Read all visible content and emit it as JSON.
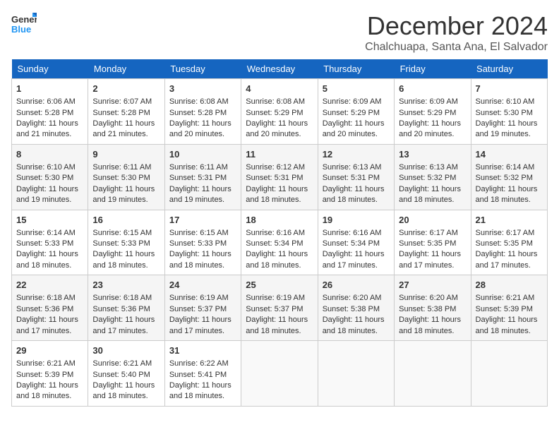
{
  "header": {
    "logo_general": "General",
    "logo_blue": "Blue",
    "month_title": "December 2024",
    "location": "Chalchuapa, Santa Ana, El Salvador"
  },
  "days_of_week": [
    "Sunday",
    "Monday",
    "Tuesday",
    "Wednesday",
    "Thursday",
    "Friday",
    "Saturday"
  ],
  "weeks": [
    [
      {
        "day": "1",
        "sunrise": "6:06 AM",
        "sunset": "5:28 PM",
        "daylight": "11 hours and 21 minutes."
      },
      {
        "day": "2",
        "sunrise": "6:07 AM",
        "sunset": "5:28 PM",
        "daylight": "11 hours and 21 minutes."
      },
      {
        "day": "3",
        "sunrise": "6:08 AM",
        "sunset": "5:28 PM",
        "daylight": "11 hours and 20 minutes."
      },
      {
        "day": "4",
        "sunrise": "6:08 AM",
        "sunset": "5:29 PM",
        "daylight": "11 hours and 20 minutes."
      },
      {
        "day": "5",
        "sunrise": "6:09 AM",
        "sunset": "5:29 PM",
        "daylight": "11 hours and 20 minutes."
      },
      {
        "day": "6",
        "sunrise": "6:09 AM",
        "sunset": "5:29 PM",
        "daylight": "11 hours and 20 minutes."
      },
      {
        "day": "7",
        "sunrise": "6:10 AM",
        "sunset": "5:30 PM",
        "daylight": "11 hours and 19 minutes."
      }
    ],
    [
      {
        "day": "8",
        "sunrise": "6:10 AM",
        "sunset": "5:30 PM",
        "daylight": "11 hours and 19 minutes."
      },
      {
        "day": "9",
        "sunrise": "6:11 AM",
        "sunset": "5:30 PM",
        "daylight": "11 hours and 19 minutes."
      },
      {
        "day": "10",
        "sunrise": "6:11 AM",
        "sunset": "5:31 PM",
        "daylight": "11 hours and 19 minutes."
      },
      {
        "day": "11",
        "sunrise": "6:12 AM",
        "sunset": "5:31 PM",
        "daylight": "11 hours and 18 minutes."
      },
      {
        "day": "12",
        "sunrise": "6:13 AM",
        "sunset": "5:31 PM",
        "daylight": "11 hours and 18 minutes."
      },
      {
        "day": "13",
        "sunrise": "6:13 AM",
        "sunset": "5:32 PM",
        "daylight": "11 hours and 18 minutes."
      },
      {
        "day": "14",
        "sunrise": "6:14 AM",
        "sunset": "5:32 PM",
        "daylight": "11 hours and 18 minutes."
      }
    ],
    [
      {
        "day": "15",
        "sunrise": "6:14 AM",
        "sunset": "5:33 PM",
        "daylight": "11 hours and 18 minutes."
      },
      {
        "day": "16",
        "sunrise": "6:15 AM",
        "sunset": "5:33 PM",
        "daylight": "11 hours and 18 minutes."
      },
      {
        "day": "17",
        "sunrise": "6:15 AM",
        "sunset": "5:33 PM",
        "daylight": "11 hours and 18 minutes."
      },
      {
        "day": "18",
        "sunrise": "6:16 AM",
        "sunset": "5:34 PM",
        "daylight": "11 hours and 18 minutes."
      },
      {
        "day": "19",
        "sunrise": "6:16 AM",
        "sunset": "5:34 PM",
        "daylight": "11 hours and 17 minutes."
      },
      {
        "day": "20",
        "sunrise": "6:17 AM",
        "sunset": "5:35 PM",
        "daylight": "11 hours and 17 minutes."
      },
      {
        "day": "21",
        "sunrise": "6:17 AM",
        "sunset": "5:35 PM",
        "daylight": "11 hours and 17 minutes."
      }
    ],
    [
      {
        "day": "22",
        "sunrise": "6:18 AM",
        "sunset": "5:36 PM",
        "daylight": "11 hours and 17 minutes."
      },
      {
        "day": "23",
        "sunrise": "6:18 AM",
        "sunset": "5:36 PM",
        "daylight": "11 hours and 17 minutes."
      },
      {
        "day": "24",
        "sunrise": "6:19 AM",
        "sunset": "5:37 PM",
        "daylight": "11 hours and 17 minutes."
      },
      {
        "day": "25",
        "sunrise": "6:19 AM",
        "sunset": "5:37 PM",
        "daylight": "11 hours and 18 minutes."
      },
      {
        "day": "26",
        "sunrise": "6:20 AM",
        "sunset": "5:38 PM",
        "daylight": "11 hours and 18 minutes."
      },
      {
        "day": "27",
        "sunrise": "6:20 AM",
        "sunset": "5:38 PM",
        "daylight": "11 hours and 18 minutes."
      },
      {
        "day": "28",
        "sunrise": "6:21 AM",
        "sunset": "5:39 PM",
        "daylight": "11 hours and 18 minutes."
      }
    ],
    [
      {
        "day": "29",
        "sunrise": "6:21 AM",
        "sunset": "5:39 PM",
        "daylight": "11 hours and 18 minutes."
      },
      {
        "day": "30",
        "sunrise": "6:21 AM",
        "sunset": "5:40 PM",
        "daylight": "11 hours and 18 minutes."
      },
      {
        "day": "31",
        "sunrise": "6:22 AM",
        "sunset": "5:41 PM",
        "daylight": "11 hours and 18 minutes."
      },
      null,
      null,
      null,
      null
    ]
  ],
  "labels": {
    "sunrise": "Sunrise: ",
    "sunset": "Sunset: ",
    "daylight": "Daylight: "
  }
}
